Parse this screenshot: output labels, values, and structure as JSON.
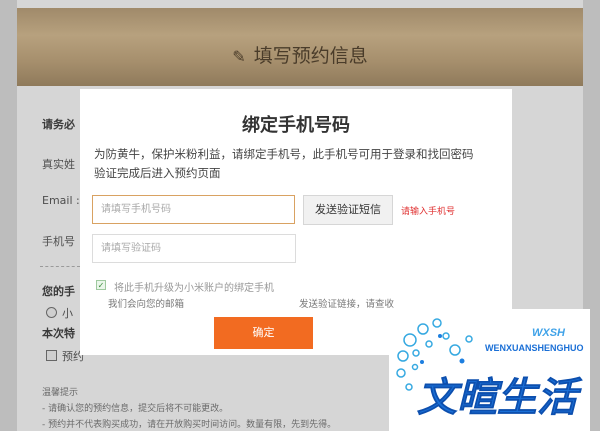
{
  "background": {
    "title": "填写预约信息",
    "section_title": "请务必",
    "field_name_label": "真实姓",
    "field_email_label": "Email :",
    "field_phone_label": "手机号",
    "phone_prompt_label": "您的手",
    "radio_option": "小",
    "special_label": "本次特",
    "checkbox_label": "预约",
    "tips_title": "温馨提示",
    "tip_1": "- 请确认您的预约信息，提交后将不可能更改。",
    "tip_2": "- 预约并不代表购买成功，请在开放购买时间访问。数量有限，先到先得。"
  },
  "modal": {
    "title": "绑定手机号码",
    "desc_line_1": "为防黄牛，保护米粉利益，请绑定手机号，此手机号可用于登录和找回密码",
    "desc_line_2": "验证完成后进入预约页面",
    "phone_placeholder": "请填写手机号码",
    "send_code_label": "发送验证短信",
    "phone_error": "请输入手机号",
    "code_placeholder": "请填写验证码",
    "upgrade_label": "将此手机升级为小米账户的绑定手机",
    "notice_part_1": "我们会向您的邮箱",
    "notice_part_2": "发送验证链接，请查收",
    "confirm_label": "确定",
    "upgrade_checked": true
  },
  "watermark": {
    "romanized": "WENXUANSHENGHUO",
    "abbr": "WXSH",
    "brand_text": "文暄生活"
  },
  "colors": {
    "accent_orange": "#f26b21",
    "error_red": "#e03232",
    "watermark_blue": "#1a6fd6"
  }
}
